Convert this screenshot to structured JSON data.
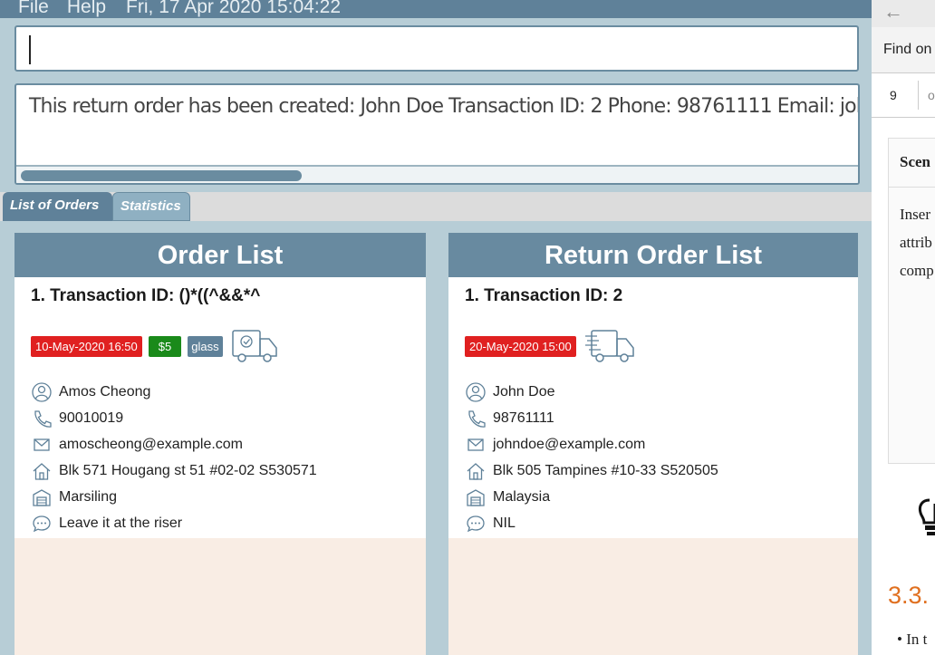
{
  "menubar": {
    "file": "File",
    "help": "Help",
    "datetime": "Fri, 17 Apr 2020 15:04:22"
  },
  "command_box": {
    "value": ""
  },
  "result": {
    "text": "This return order has been created: John Doe Transaction ID: 2 Phone: 98761111 Email: johndoe@exam"
  },
  "tabs": {
    "orders": "List of Orders",
    "statistics": "Statistics"
  },
  "order_list": {
    "title": "Order List",
    "items": [
      {
        "title": "1.  Transaction ID: ()*((^&&*^",
        "date": "10-May-2020 16:50",
        "price": "$5",
        "tag": "glass",
        "name": "Amos Cheong",
        "phone": "90010019",
        "email": "amoscheong@example.com",
        "address": "Blk 571 Hougang st 51 #02-02 S530571",
        "warehouse": "Marsiling",
        "comment": "Leave it at the riser"
      }
    ]
  },
  "return_list": {
    "title": "Return Order List",
    "items": [
      {
        "title": "1.  Transaction ID: 2",
        "date": "20-May-2020 15:00",
        "name": "John Doe",
        "phone": "98761111",
        "email": "johndoe@example.com",
        "address": "Blk 505 Tampines #10-33 S520505",
        "warehouse": "Malaysia",
        "comment": "NIL"
      }
    ]
  },
  "sidebar": {
    "find_label": "Find on",
    "find_value": "9",
    "find_suffix": "o",
    "scenario_heading": "Scen",
    "scenario_lines": [
      "Inser",
      "attrib",
      "comp"
    ],
    "section": "3.3.",
    "bullet": "• In t"
  },
  "colors": {
    "accent": "#688aa0",
    "date_badge": "#e02020",
    "price_badge": "#1a8a1a",
    "tag_badge": "#5f8199",
    "list_bg": "#f9ede4"
  }
}
